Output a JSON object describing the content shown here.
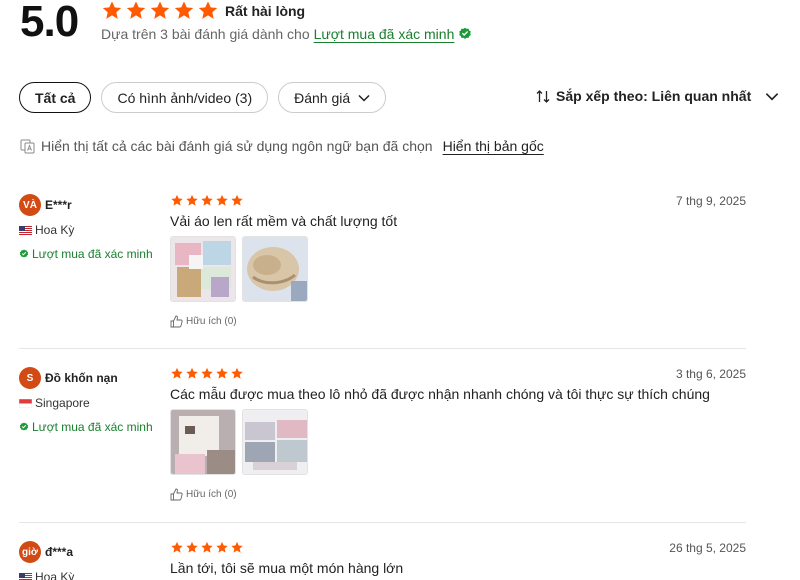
{
  "summary": {
    "score": "5.0",
    "star_count": 5,
    "rating_label": "Rất hài lòng",
    "based_on_text": "Dựa trên 3 bài đánh giá dành cho",
    "verified_link": "Lượt mua đã xác minh",
    "accent_color": "#ff5a00",
    "verified_color": "#1a7f2e"
  },
  "filters": [
    {
      "label": "Tất cả",
      "active": true
    },
    {
      "label": "Có hình ảnh/video (3)",
      "active": false
    },
    {
      "label": "Đánh giá",
      "active": false
    }
  ],
  "sort": {
    "label": "Sắp xếp theo: Liên quan nhất"
  },
  "translation": {
    "note": "Hiển thị tất cả các bài đánh giá sử dụng ngôn ngữ bạn đã chọn",
    "link": "Hiển thị bản gốc"
  },
  "reviews": [
    {
      "avatar": "VÀ",
      "name": "E***r",
      "country": "Hoa Kỳ",
      "flag": "us",
      "verified": "Lượt mua đã xác minh",
      "stars": 5,
      "date": "7 thg 9, 2025",
      "text": "Vải áo len rất mềm và chất lượng tốt",
      "photos": [
        "sweater-colors",
        "beige-knit"
      ],
      "helpful": "Hữu ích (0)"
    },
    {
      "avatar": "S",
      "name": "Đồ khốn nạn",
      "country": "Singapore",
      "flag": "sg",
      "verified": "Lượt mua đã xác minh",
      "stars": 5,
      "date": "3 thg 6, 2025",
      "text": "Các mẫu được mua theo lô nhỏ đã được nhận nhanh chóng và tôi thực sự thích chúng",
      "photos": [
        "white-sweater",
        "folded-clothes"
      ],
      "helpful": "Hữu ích (0)"
    },
    {
      "avatar": "giờ",
      "name": "đ***a",
      "country": "Hoa Kỳ",
      "flag": "us",
      "verified": "",
      "stars": 5,
      "date": "26 thg 5, 2025",
      "text": "Lần tới, tôi sẽ mua một món hàng lớn",
      "photos": [],
      "helpful": ""
    }
  ]
}
